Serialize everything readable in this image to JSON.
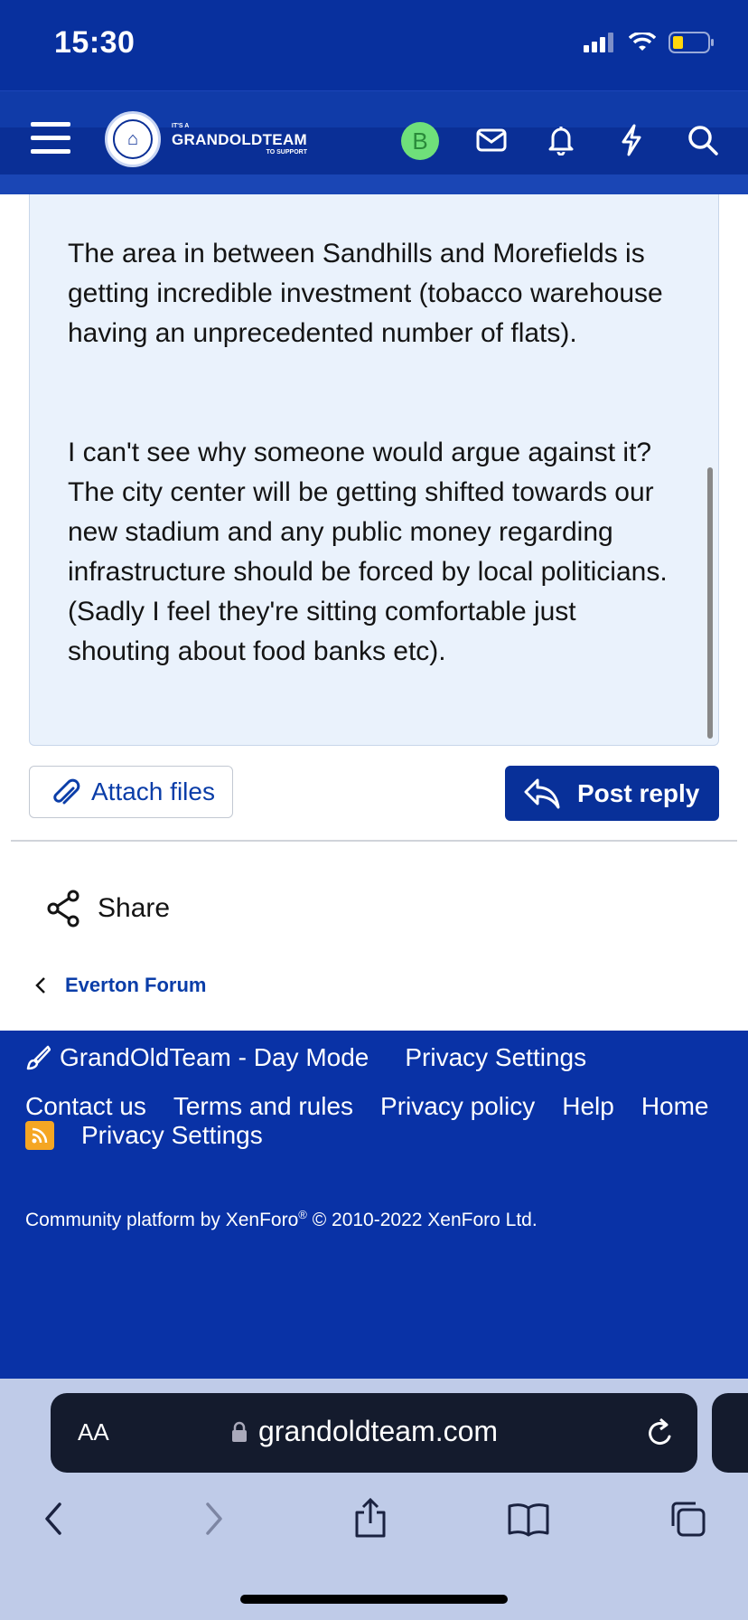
{
  "status_bar": {
    "time": "15:30"
  },
  "header": {
    "logo": {
      "line1": "IT'S A",
      "line2": "GRANDOLDTEAM",
      "line3": "TO SUPPORT"
    },
    "avatar_letter": "B"
  },
  "message": {
    "paragraphs": [
      "The area in between Sandhills and Morefields is getting incredible investment (tobacco warehouse having an unprecedented number of flats).",
      "I can't see why someone would argue against it? The city center will be getting shifted towards our new stadium and any public money regarding infrastructure should be forced by local politicians. (Sadly I feel they're sitting comfortable just shouting about food banks etc)."
    ]
  },
  "actions": {
    "attach_label": "Attach files",
    "reply_label": "Post reply"
  },
  "share_label": "Share",
  "breadcrumb": {
    "label": "Everton Forum"
  },
  "footer": {
    "style_label": "GrandOldTeam - Day Mode",
    "privacy_settings_1": "Privacy Settings",
    "links": [
      "Contact us",
      "Terms and rules",
      "Privacy policy",
      "Help",
      "Home"
    ],
    "privacy_settings_2": "Privacy Settings",
    "copyright_prefix": "Community platform by XenForo",
    "copyright_reg": "®",
    "copyright_suffix": " © 2010-2022 XenForo Ltd."
  },
  "browser": {
    "aa_label": "AA",
    "url": "grandoldteam.com"
  },
  "colors": {
    "brand_blue": "#0932a6",
    "accent_link": "#0a3da8",
    "message_bg": "#eaf2fc"
  }
}
